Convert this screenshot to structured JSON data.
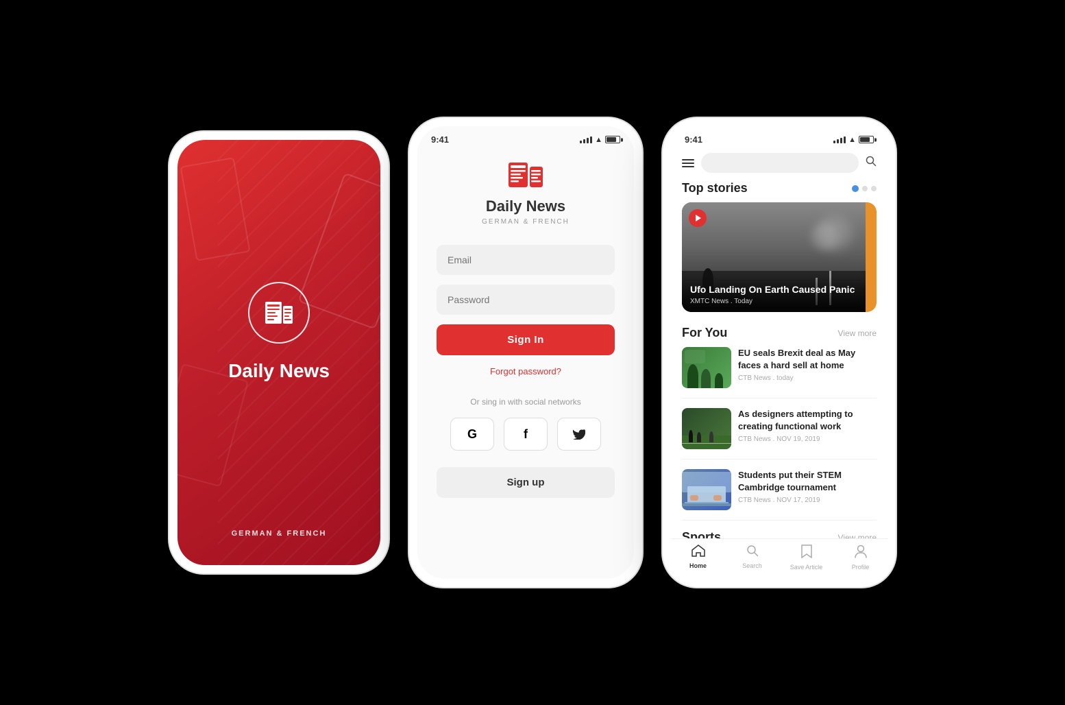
{
  "app": {
    "name": "Daily News",
    "tagline": "GERMAN & FRENCH"
  },
  "phone1": {
    "title": "Daily News",
    "subtitle": "GERMAN & FRENCH"
  },
  "phone2": {
    "status_time": "9:41",
    "logo_text": "Daily News",
    "logo_sub": "GERMAN & FRENCH",
    "email_placeholder": "Email",
    "password_placeholder": "Password",
    "signin_label": "Sign In",
    "forgot_label": "Forgot password?",
    "social_divider": "Or sing in with social networks",
    "google_icon": "G",
    "facebook_icon": "f",
    "twitter_icon": "𝕏",
    "signup_label": "Sign up"
  },
  "phone3": {
    "status_time": "9:41",
    "search_placeholder": "",
    "top_stories_title": "Top stories",
    "top_story": {
      "headline": "Ufo Landing On Earth Caused Panic",
      "source": "XMTC News",
      "time": "Today"
    },
    "for_you_title": "For You",
    "view_more_label": "View more",
    "articles": [
      {
        "headline": "EU seals Brexit deal as May faces a hard sell at home",
        "source": "CTB News",
        "time": "today",
        "thumb_type": "green"
      },
      {
        "headline": "As designers attempting to creating functional work",
        "source": "CTB News",
        "time": "NOV 19, 2019",
        "thumb_type": "sports"
      },
      {
        "headline": "Students put their STEM Cambridge tournament",
        "source": "CTB News",
        "time": "NOV 17, 2019",
        "thumb_type": "laptop"
      }
    ],
    "sports_title": "Sports",
    "nav": {
      "home": "Home",
      "search": "Search",
      "save": "Save Article",
      "profile": "Profile"
    }
  }
}
